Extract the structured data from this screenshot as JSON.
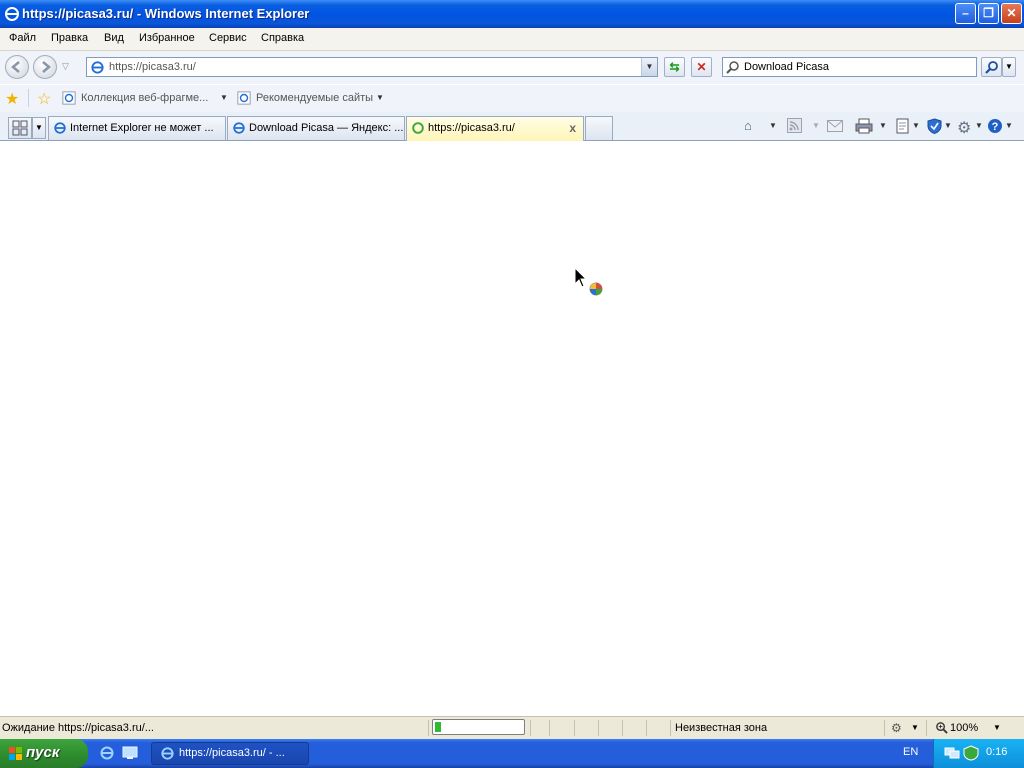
{
  "window": {
    "title": "https://picasa3.ru/ - Windows Internet Explorer"
  },
  "menu": {
    "items": [
      "Файл",
      "Правка",
      "Вид",
      "Избранное",
      "Сервис",
      "Справка"
    ]
  },
  "nav": {
    "address": "https://picasa3.ru/",
    "search_value": "Download Picasa"
  },
  "favorites": {
    "web_slice_gallery": "Коллекция веб-фрагме...",
    "suggested_sites": "Рекомендуемые сайты"
  },
  "tabs": [
    {
      "label": "Internet Explorer не может ..."
    },
    {
      "label": "Download Picasa — Яндекс: ..."
    },
    {
      "label": "https://picasa3.ru/",
      "close": "x"
    }
  ],
  "status": {
    "text": "Ожидание https://picasa3.ru/...",
    "zone": "Неизвестная зона",
    "zoom": "100%",
    "progress_fraction": 0.07
  },
  "taskbar": {
    "start_label": "пуск",
    "task_label": "https://picasa3.ru/ - ...",
    "lang": "EN",
    "clock": "0:16"
  },
  "colors": {
    "title_bar": "#0054e3",
    "taskbar": "#245edb",
    "start_button": "#2c8a2c",
    "active_tab": "#fff5b8",
    "progress_fill": "#2fbb2f"
  }
}
